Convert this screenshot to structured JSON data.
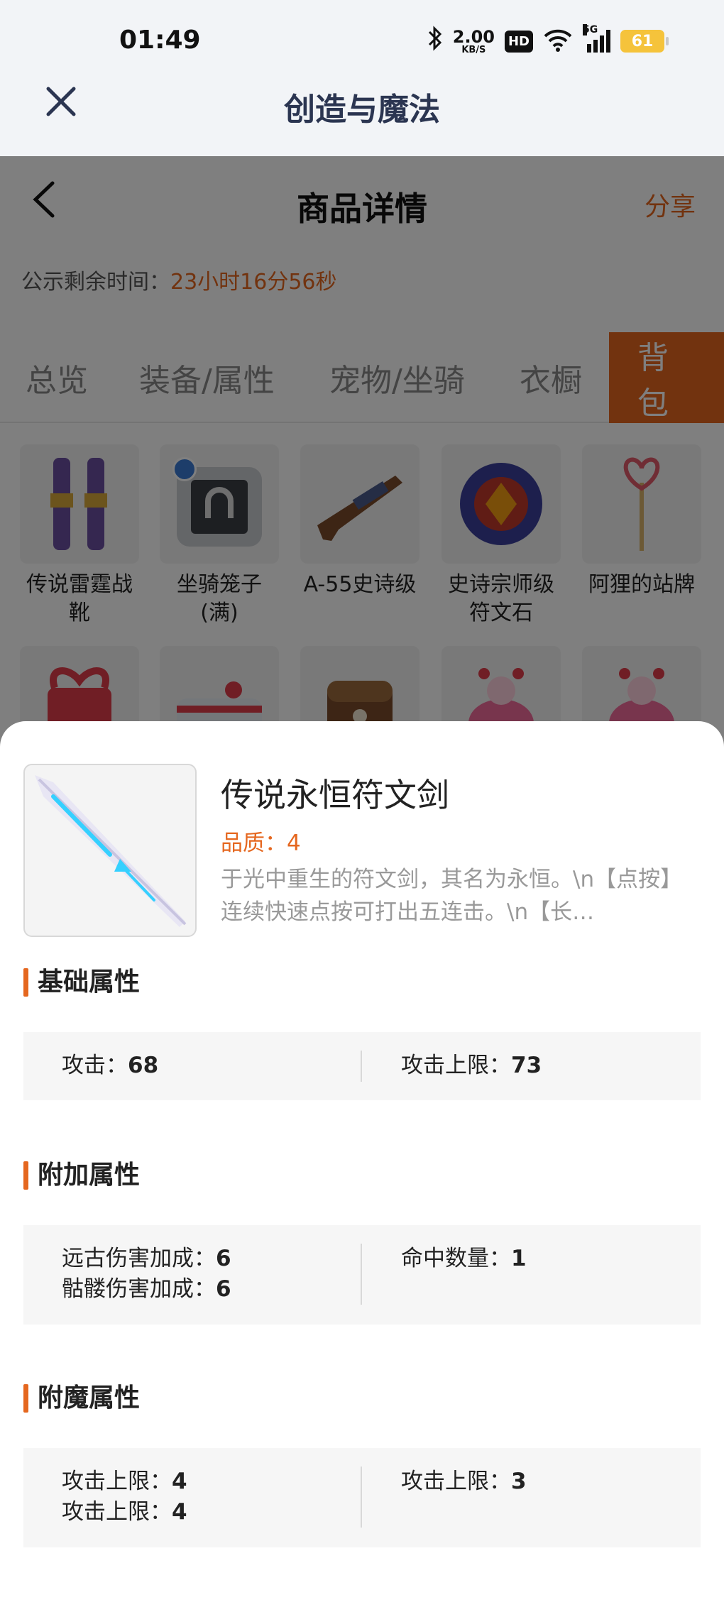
{
  "status_bar": {
    "time": "01:49",
    "net_speed_value": "2.00",
    "net_speed_unit": "KB/S",
    "hd_badge": "HD",
    "signal_label": "5G",
    "battery": "61"
  },
  "app_bar": {
    "title": "创造与魔法"
  },
  "detail_page": {
    "title": "商品详情",
    "share_label": "分享",
    "remain_label": "公示剩余时间：",
    "remain_time": "23小时16分56秒",
    "tabs": [
      {
        "label": "总览"
      },
      {
        "label": "装备/属性"
      },
      {
        "label": "宠物/坐骑"
      },
      {
        "label": "衣橱"
      },
      {
        "label": "背包",
        "active": true
      }
    ],
    "items": [
      {
        "label": "传说雷霆战靴"
      },
      {
        "label": "坐骑笼子(满)"
      },
      {
        "label": "A-55史诗级"
      },
      {
        "label": "史诗宗师级符文石"
      },
      {
        "label": "阿狸的站牌"
      }
    ],
    "badge_icon": "horseshoe-icon"
  },
  "sheet": {
    "item_name": "传说永恒符文剑",
    "quality": "品质：4",
    "description": "于光中重生的符文剑，其名为永恒。\\n【点按】连续快速点按可打出五连击。\\n【长…",
    "sections": [
      {
        "title": "基础属性",
        "left": [
          {
            "label": "攻击：",
            "value": "68"
          }
        ],
        "right": [
          {
            "label": "攻击上限：",
            "value": "73"
          }
        ]
      },
      {
        "title": "附加属性",
        "left": [
          {
            "label": "远古伤害加成：",
            "value": "6"
          },
          {
            "label": "骷髅伤害加成：",
            "value": "6"
          }
        ],
        "right": [
          {
            "label": "命中数量：",
            "value": "1"
          }
        ]
      },
      {
        "title": "附魔属性",
        "left": [
          {
            "label": "攻击上限：",
            "value": "4"
          },
          {
            "label": "攻击上限：",
            "value": "4"
          }
        ],
        "right": [
          {
            "label": "攻击上限：",
            "value": "3"
          }
        ]
      }
    ]
  },
  "colors": {
    "accent": "#e5671f",
    "title_text": "#2b3551"
  }
}
